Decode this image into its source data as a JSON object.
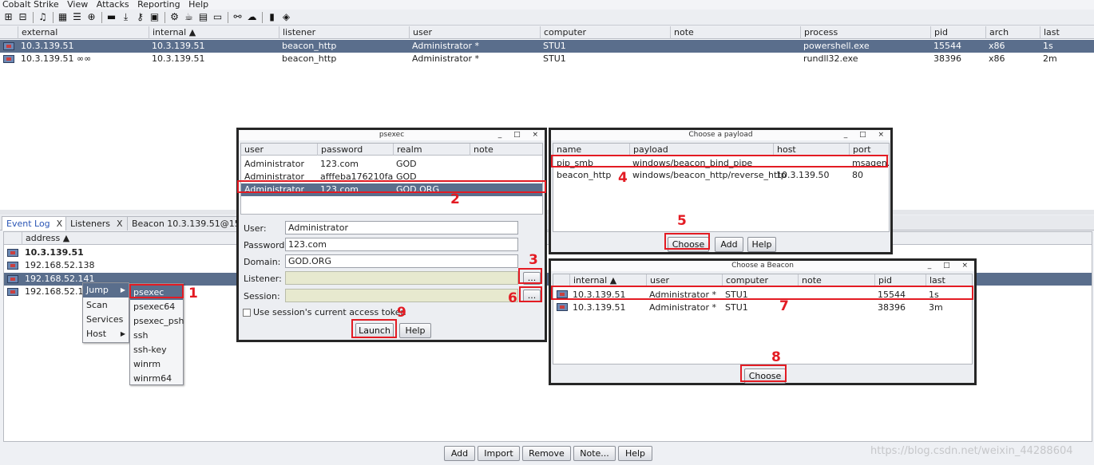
{
  "menubar": [
    "Cobalt Strike",
    "View",
    "Attacks",
    "Reporting",
    "Help"
  ],
  "toolbar_icons": [
    "new-connection-icon",
    "disconnect-icon",
    "headphones-icon",
    "pivot-graph-icon",
    "session-table-icon",
    "targets-icon",
    "image-icon",
    "download-icon",
    "keystrokes-icon",
    "screenshot-icon",
    "settings-icon",
    "coffee-icon",
    "report-icon",
    "console-icon",
    "link-icon",
    "cloud-icon",
    "server-icon",
    "package-icon"
  ],
  "beacons": {
    "columns": [
      "external",
      "internal ▲",
      "listener",
      "user",
      "computer",
      "note",
      "process",
      "pid",
      "arch",
      "last"
    ],
    "rows": [
      {
        "external": "10.3.139.51",
        "internal": "10.3.139.51",
        "listener": "beacon_http",
        "user": "Administrator *",
        "computer": "STU1",
        "note": "",
        "process": "powershell.exe",
        "pid": "15544",
        "arch": "x86",
        "last": "1s"
      },
      {
        "external": "10.3.139.51 ∞∞",
        "internal": "10.3.139.51",
        "listener": "beacon_http",
        "user": "Administrator *",
        "computer": "STU1",
        "note": "",
        "process": "rundll32.exe",
        "pid": "38396",
        "arch": "x86",
        "last": "2m"
      }
    ]
  },
  "tabs": [
    {
      "label": "Event Log",
      "close": "X"
    },
    {
      "label": "Listeners",
      "close": "X"
    },
    {
      "label": "Beacon 10.3.139.51@155",
      "close": ""
    }
  ],
  "targets": {
    "column": "address ▲",
    "rows": [
      "10.3.139.51",
      "192.168.52.138",
      "192.168.52.141",
      "192.168.52.14"
    ]
  },
  "context_menu": {
    "items": [
      "Jump",
      "Scan",
      "Services",
      "Host"
    ],
    "submenu": [
      "psexec",
      "psexec64",
      "psexec_psh",
      "ssh",
      "ssh-key",
      "winrm",
      "winrm64"
    ]
  },
  "psexec": {
    "title": "psexec",
    "columns": [
      "user",
      "password",
      "realm",
      "note"
    ],
    "rows": [
      {
        "user": "Administrator",
        "password": "123.com",
        "realm": "GOD",
        "note": ""
      },
      {
        "user": "Administrator",
        "password": "afffeba176210fad...",
        "realm": "GOD",
        "note": ""
      },
      {
        "user": "Administrator",
        "password": "123.com",
        "realm": "GOD.ORG",
        "note": ""
      }
    ],
    "labels": {
      "user": "User:",
      "password": "Password:",
      "domain": "Domain:",
      "listener": "Listener:",
      "session": "Session:"
    },
    "values": {
      "user": "Administrator",
      "password": "123.com",
      "domain": "GOD.ORG",
      "listener": "",
      "session": ""
    },
    "browse": "...",
    "checkbox": "Use session's current access token",
    "launch": "Launch",
    "help": "Help"
  },
  "payload": {
    "title": "Choose a payload",
    "columns": [
      "name",
      "payload",
      "host",
      "port"
    ],
    "rows": [
      {
        "name": "pip_smb",
        "payload": "windows/beacon_bind_pipe",
        "host": "",
        "port": "msagen..."
      },
      {
        "name": "beacon_http",
        "payload": "windows/beacon_http/reverse_http",
        "host": "10.3.139.50",
        "port": "80"
      }
    ],
    "choose": "Choose",
    "add": "Add",
    "help": "Help"
  },
  "beacon_dialog": {
    "title": "Choose a Beacon",
    "columns": [
      "internal ▲",
      "user",
      "computer",
      "note",
      "pid",
      "last"
    ],
    "rows": [
      {
        "internal": "10.3.139.51",
        "user": "Administrator *",
        "computer": "STU1",
        "note": "",
        "pid": "15544",
        "last": "1s"
      },
      {
        "internal": "10.3.139.51",
        "user": "Administrator *",
        "computer": "STU1",
        "note": "",
        "pid": "38396",
        "last": "3m"
      }
    ],
    "choose": "Choose"
  },
  "bottom_buttons": [
    "Add",
    "Import",
    "Remove",
    "Note...",
    "Help"
  ],
  "dialog_controls": "_ □ ×",
  "annotations": [
    "1",
    "2",
    "3",
    "4",
    "5",
    "6",
    "7",
    "8",
    "9"
  ],
  "watermark": "https://blog.csdn.net/weixin_44288604",
  "colors": {
    "selection": "#5a6e8c",
    "annotation": "#e31b23",
    "dialog_border": "#262626"
  }
}
